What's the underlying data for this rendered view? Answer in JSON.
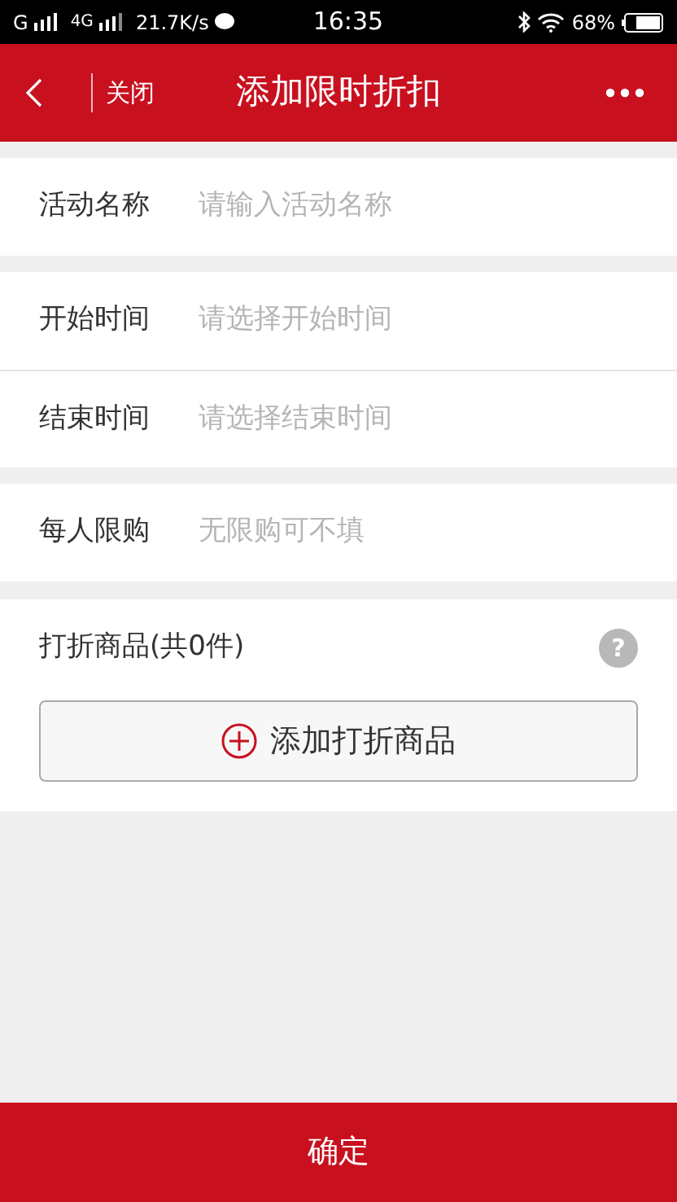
{
  "status_bar": {
    "carrier_1": "G",
    "carrier_2": "4G",
    "speed": "21.7K/s",
    "time": "16:35",
    "battery": "68%"
  },
  "header": {
    "close": "关闭",
    "title": "添加限时折扣"
  },
  "sections": [
    {
      "rows": [
        {
          "label": "活动名称",
          "placeholder": "请输入活动名称"
        }
      ]
    },
    {
      "rows": [
        {
          "label": "开始时间",
          "placeholder": "请选择开始时间"
        },
        {
          "label": "结束时间",
          "placeholder": "请选择结束时间"
        }
      ]
    },
    {
      "rows": [
        {
          "label": "每人限购",
          "placeholder": "无限购可不填"
        }
      ]
    }
  ],
  "products": {
    "title": "打折商品(共0件)",
    "help_mark": "?",
    "add_button": "添加打折商品"
  },
  "footer": {
    "confirm": "确定"
  }
}
